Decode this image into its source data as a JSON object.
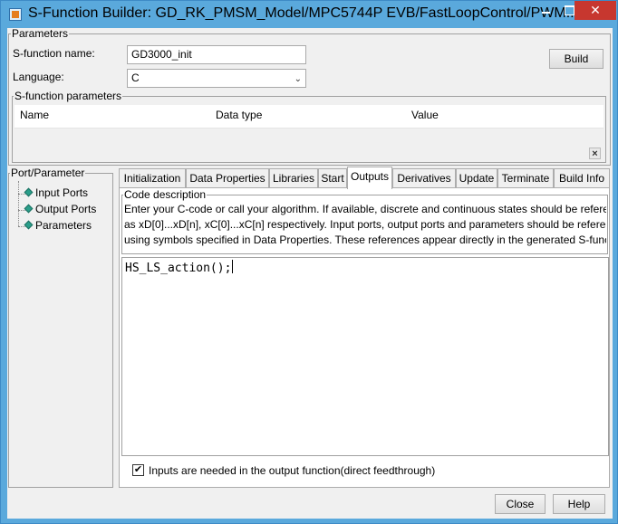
{
  "window": {
    "title": "S-Function Builder: GD_RK_PMSM_Model/MPC5744P EVB/FastLoopControl/PWM...",
    "close_glyph": "✕"
  },
  "parameters": {
    "legend": "Parameters",
    "sfunction_name_label": "S-function name:",
    "sfunction_name_value": "GD3000_init",
    "language_label": "Language:",
    "language_value": "C",
    "build_label": "Build"
  },
  "sfunction_params": {
    "legend": "S-function parameters",
    "columns": [
      "Name",
      "Data type",
      "Value"
    ],
    "delete_glyph": "×"
  },
  "port_parameter": {
    "legend": "Port/Parameter",
    "items": [
      "Input Ports",
      "Output Ports",
      "Parameters"
    ]
  },
  "tabs": [
    {
      "label": "Initialization",
      "active": false
    },
    {
      "label": "Data Properties",
      "active": false
    },
    {
      "label": "Libraries",
      "active": false
    },
    {
      "label": "Start",
      "active": false
    },
    {
      "label": "Outputs",
      "active": true
    },
    {
      "label": "Derivatives",
      "active": false
    },
    {
      "label": "Update",
      "active": false
    },
    {
      "label": "Terminate",
      "active": false
    },
    {
      "label": "Build Info",
      "active": false
    }
  ],
  "outputs": {
    "code_description_legend": "Code description",
    "description_lines": [
      "Enter your C-code or call your algorithm. If available, discrete and continuous states should be referen",
      "as xD[0]...xD[n], xC[0]...xC[n] respectively. Input ports, output ports and parameters should be referenc",
      "using symbols specified in Data Properties. These references appear directly in the generated S-funct"
    ],
    "code": "HS_LS_action();",
    "checkbox_checked": true,
    "checkbox_glyph": "✔",
    "checkbox_label": "Inputs are needed in the output function(direct feedthrough)"
  },
  "footer": {
    "close_label": "Close",
    "help_label": "Help"
  },
  "colors": {
    "titlebar": "#5aa9dc",
    "close_button": "#c7372f",
    "tree_icon": "#2a9e8a"
  }
}
